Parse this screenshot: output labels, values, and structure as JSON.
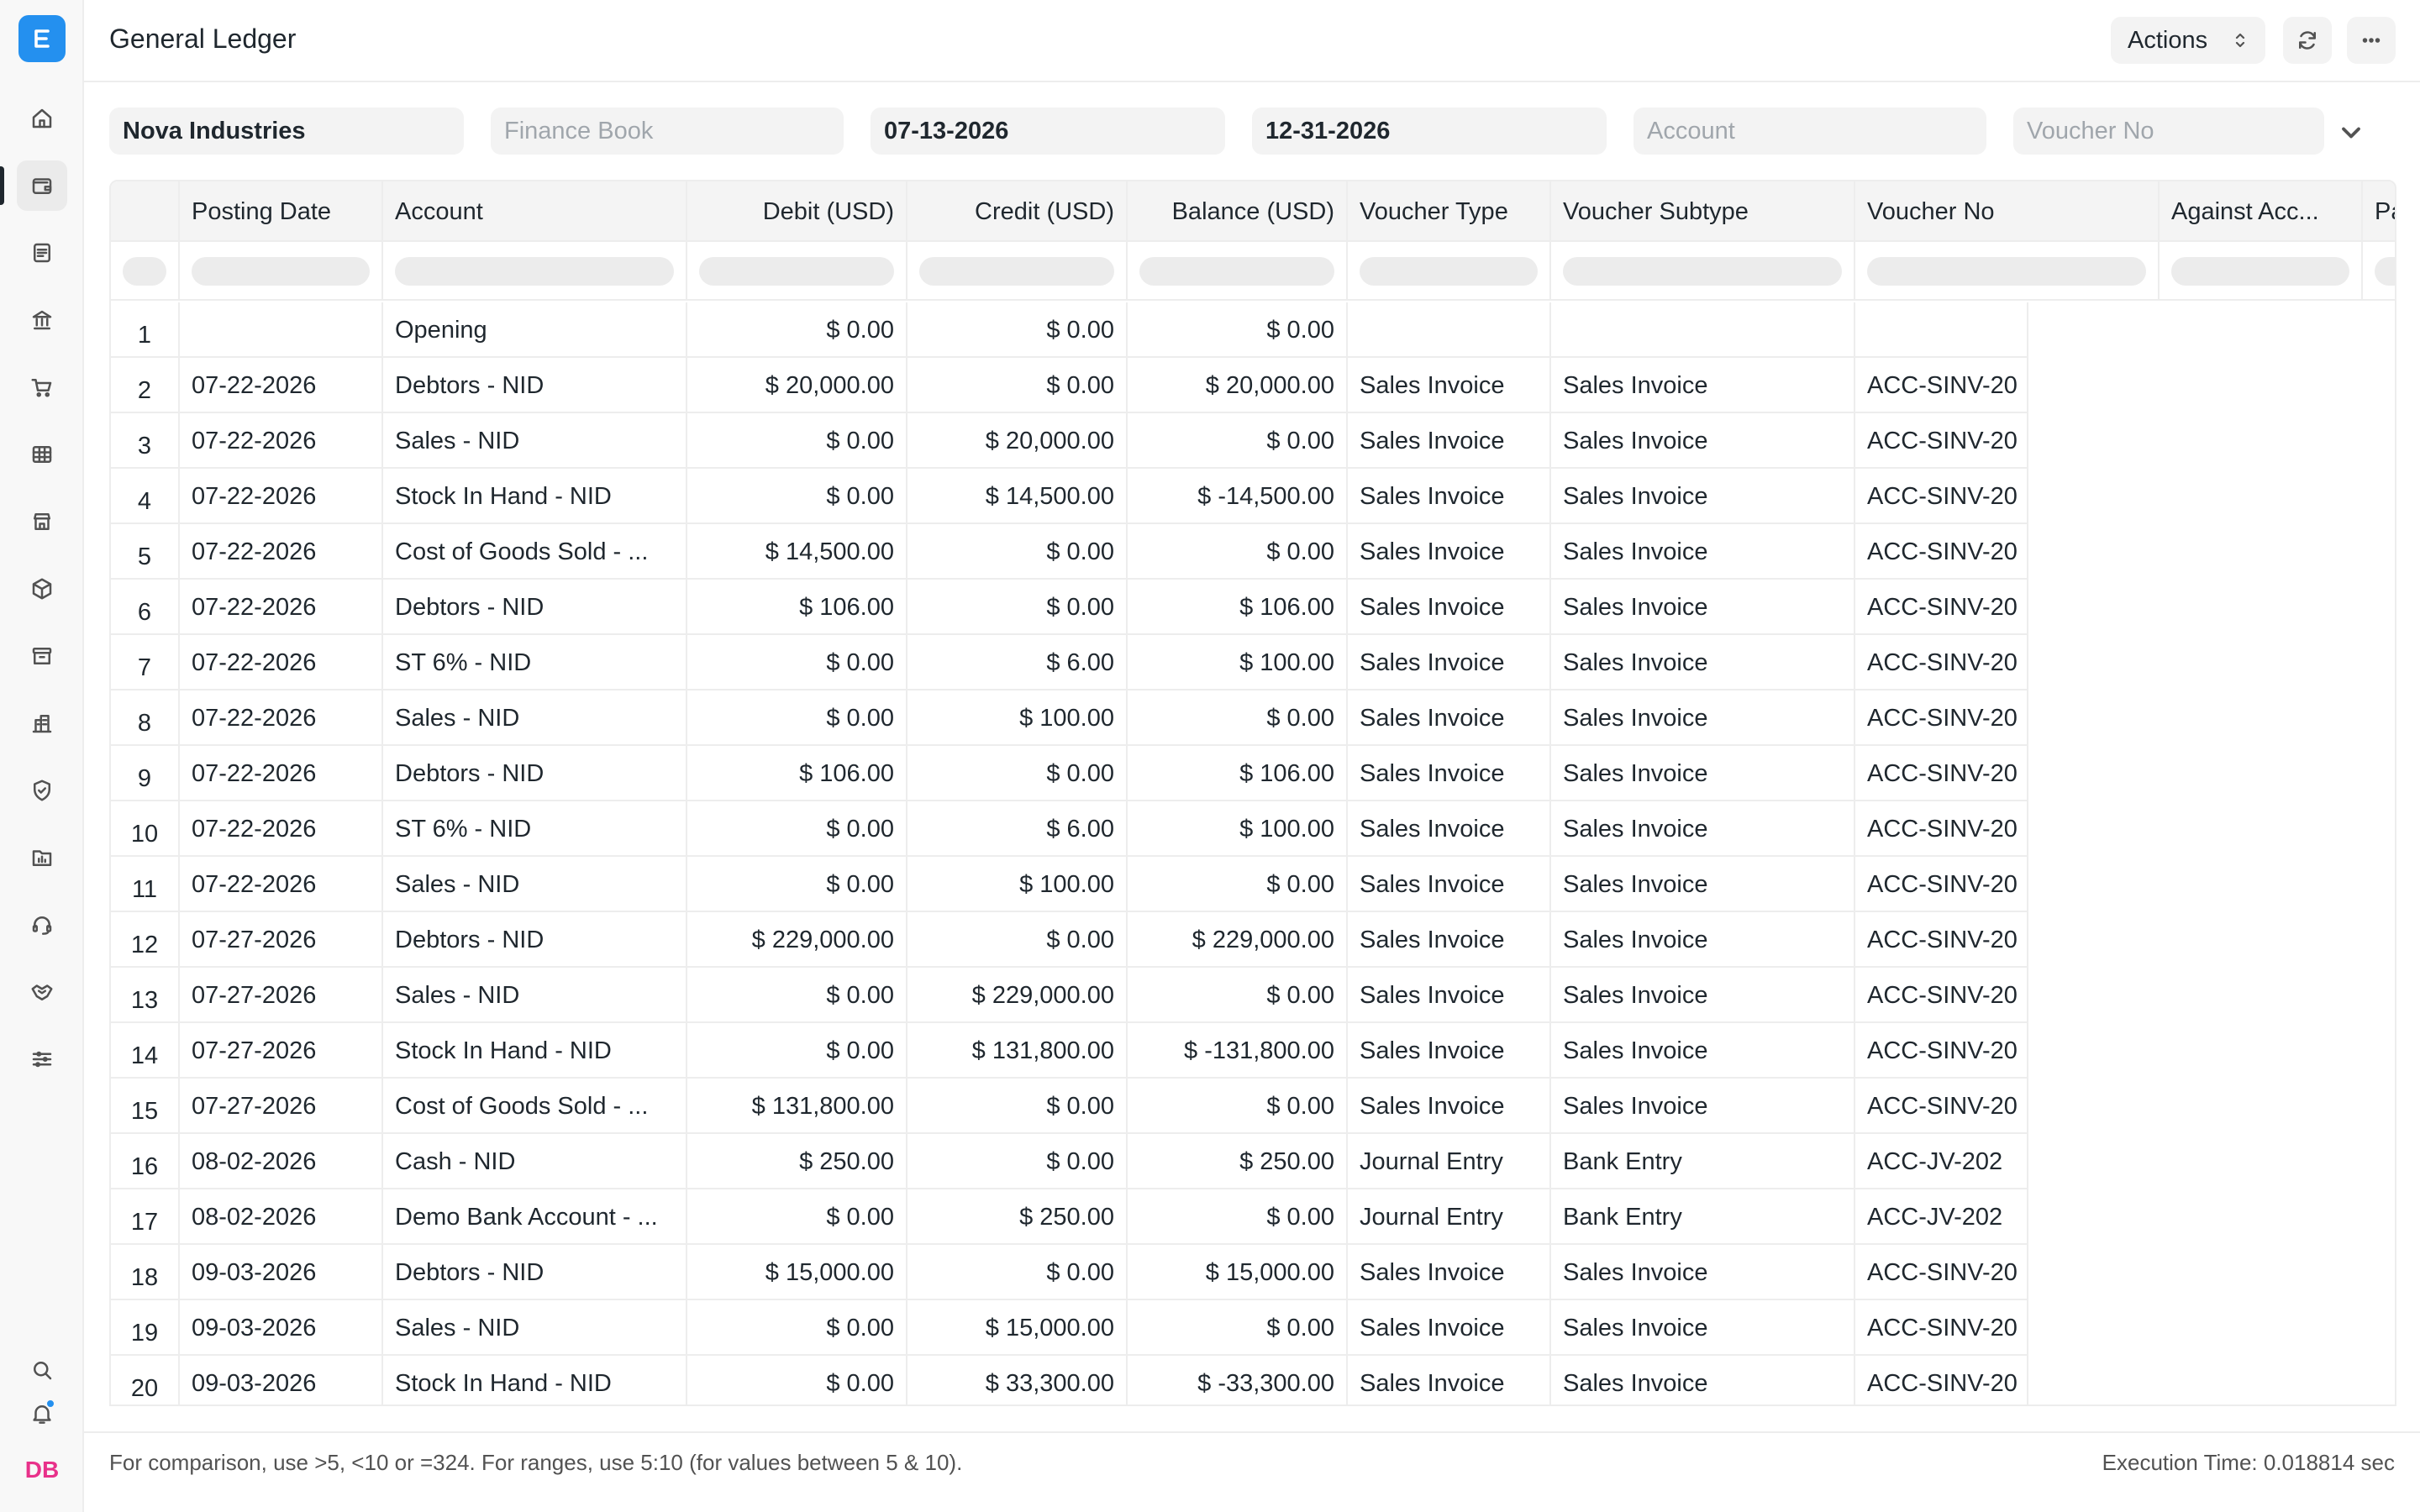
{
  "header": {
    "title": "General Ledger",
    "actions_label": "Actions"
  },
  "filters": {
    "company": "Nova Industries",
    "finance_book_placeholder": "Finance Book",
    "from_date": "07-13-2026",
    "to_date": "12-31-2026",
    "account_placeholder": "Account",
    "voucher_no_placeholder": "Voucher No"
  },
  "table": {
    "columns": [
      "Posting Date",
      "Account",
      "Debit (USD)",
      "Credit (USD)",
      "Balance (USD)",
      "Voucher Type",
      "Voucher Subtype",
      "Voucher No",
      "Against Acc...",
      "Pa"
    ],
    "rows": [
      {
        "idx": "1",
        "date": "",
        "account": "Opening",
        "debit": "$ 0.00",
        "credit": "$ 0.00",
        "balance": "$ 0.00",
        "vtype": "",
        "vsub": "",
        "vno": ""
      },
      {
        "idx": "2",
        "date": "07-22-2026",
        "account": "Debtors - NID",
        "debit": "$ 20,000.00",
        "credit": "$ 0.00",
        "balance": "$ 20,000.00",
        "vtype": "Sales Invoice",
        "vsub": "Sales Invoice",
        "vno": "ACC-SINV-20"
      },
      {
        "idx": "3",
        "date": "07-22-2026",
        "account": "Sales - NID",
        "debit": "$ 0.00",
        "credit": "$ 20,000.00",
        "balance": "$ 0.00",
        "vtype": "Sales Invoice",
        "vsub": "Sales Invoice",
        "vno": "ACC-SINV-20"
      },
      {
        "idx": "4",
        "date": "07-22-2026",
        "account": "Stock In Hand - NID",
        "debit": "$ 0.00",
        "credit": "$ 14,500.00",
        "balance": "$ -14,500.00",
        "vtype": "Sales Invoice",
        "vsub": "Sales Invoice",
        "vno": "ACC-SINV-20"
      },
      {
        "idx": "5",
        "date": "07-22-2026",
        "account": "Cost of Goods Sold - ...",
        "debit": "$ 14,500.00",
        "credit": "$ 0.00",
        "balance": "$ 0.00",
        "vtype": "Sales Invoice",
        "vsub": "Sales Invoice",
        "vno": "ACC-SINV-20"
      },
      {
        "idx": "6",
        "date": "07-22-2026",
        "account": "Debtors - NID",
        "debit": "$ 106.00",
        "credit": "$ 0.00",
        "balance": "$ 106.00",
        "vtype": "Sales Invoice",
        "vsub": "Sales Invoice",
        "vno": "ACC-SINV-20"
      },
      {
        "idx": "7",
        "date": "07-22-2026",
        "account": "ST 6% - NID",
        "debit": "$ 0.00",
        "credit": "$ 6.00",
        "balance": "$ 100.00",
        "vtype": "Sales Invoice",
        "vsub": "Sales Invoice",
        "vno": "ACC-SINV-20"
      },
      {
        "idx": "8",
        "date": "07-22-2026",
        "account": "Sales - NID",
        "debit": "$ 0.00",
        "credit": "$ 100.00",
        "balance": "$ 0.00",
        "vtype": "Sales Invoice",
        "vsub": "Sales Invoice",
        "vno": "ACC-SINV-20"
      },
      {
        "idx": "9",
        "date": "07-22-2026",
        "account": "Debtors - NID",
        "debit": "$ 106.00",
        "credit": "$ 0.00",
        "balance": "$ 106.00",
        "vtype": "Sales Invoice",
        "vsub": "Sales Invoice",
        "vno": "ACC-SINV-20"
      },
      {
        "idx": "10",
        "date": "07-22-2026",
        "account": "ST 6% - NID",
        "debit": "$ 0.00",
        "credit": "$ 6.00",
        "balance": "$ 100.00",
        "vtype": "Sales Invoice",
        "vsub": "Sales Invoice",
        "vno": "ACC-SINV-20"
      },
      {
        "idx": "11",
        "date": "07-22-2026",
        "account": "Sales - NID",
        "debit": "$ 0.00",
        "credit": "$ 100.00",
        "balance": "$ 0.00",
        "vtype": "Sales Invoice",
        "vsub": "Sales Invoice",
        "vno": "ACC-SINV-20"
      },
      {
        "idx": "12",
        "date": "07-27-2026",
        "account": "Debtors - NID",
        "debit": "$ 229,000.00",
        "credit": "$ 0.00",
        "balance": "$ 229,000.00",
        "vtype": "Sales Invoice",
        "vsub": "Sales Invoice",
        "vno": "ACC-SINV-20"
      },
      {
        "idx": "13",
        "date": "07-27-2026",
        "account": "Sales - NID",
        "debit": "$ 0.00",
        "credit": "$ 229,000.00",
        "balance": "$ 0.00",
        "vtype": "Sales Invoice",
        "vsub": "Sales Invoice",
        "vno": "ACC-SINV-20"
      },
      {
        "idx": "14",
        "date": "07-27-2026",
        "account": "Stock In Hand - NID",
        "debit": "$ 0.00",
        "credit": "$ 131,800.00",
        "balance": "$ -131,800.00",
        "vtype": "Sales Invoice",
        "vsub": "Sales Invoice",
        "vno": "ACC-SINV-20"
      },
      {
        "idx": "15",
        "date": "07-27-2026",
        "account": "Cost of Goods Sold - ...",
        "debit": "$ 131,800.00",
        "credit": "$ 0.00",
        "balance": "$ 0.00",
        "vtype": "Sales Invoice",
        "vsub": "Sales Invoice",
        "vno": "ACC-SINV-20"
      },
      {
        "idx": "16",
        "date": "08-02-2026",
        "account": "Cash - NID",
        "debit": "$ 250.00",
        "credit": "$ 0.00",
        "balance": "$ 250.00",
        "vtype": "Journal Entry",
        "vsub": "Bank Entry",
        "vno": "ACC-JV-202"
      },
      {
        "idx": "17",
        "date": "08-02-2026",
        "account": "Demo Bank Account - ...",
        "debit": "$ 0.00",
        "credit": "$ 250.00",
        "balance": "$ 0.00",
        "vtype": "Journal Entry",
        "vsub": "Bank Entry",
        "vno": "ACC-JV-202"
      },
      {
        "idx": "18",
        "date": "09-03-2026",
        "account": "Debtors - NID",
        "debit": "$ 15,000.00",
        "credit": "$ 0.00",
        "balance": "$ 15,000.00",
        "vtype": "Sales Invoice",
        "vsub": "Sales Invoice",
        "vno": "ACC-SINV-20"
      },
      {
        "idx": "19",
        "date": "09-03-2026",
        "account": "Sales - NID",
        "debit": "$ 0.00",
        "credit": "$ 15,000.00",
        "balance": "$ 0.00",
        "vtype": "Sales Invoice",
        "vsub": "Sales Invoice",
        "vno": "ACC-SINV-20"
      },
      {
        "idx": "20",
        "date": "09-03-2026",
        "account": "Stock In Hand - NID",
        "debit": "$ 0.00",
        "credit": "$ 33,300.00",
        "balance": "$ -33,300.00",
        "vtype": "Sales Invoice",
        "vsub": "Sales Invoice",
        "vno": "ACC-SINV-20"
      }
    ]
  },
  "footer": {
    "hint": "For comparison, use >5, <10 or =324. For ranges, use 5:10 (for values between 5 & 10).",
    "execution_time": "Execution Time: 0.018814 sec"
  },
  "sidebar": {
    "avatar_initials": "DB",
    "icons": [
      "home-icon",
      "wallet-icon",
      "document-icon",
      "bank-icon",
      "cart-icon",
      "table-icon",
      "store-icon",
      "package-icon",
      "archive-icon",
      "building-icon",
      "shield-icon",
      "folder-chart-icon",
      "headset-icon",
      "handshake-icon",
      "sliders-icon",
      "search-icon",
      "bell-icon"
    ]
  },
  "colors": {
    "brand": "#2490ef",
    "avatar": "#e8318a",
    "text": "#1f272e"
  }
}
